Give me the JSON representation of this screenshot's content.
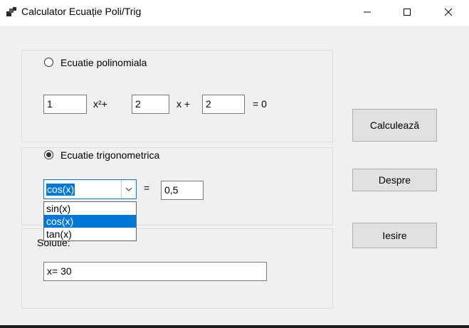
{
  "window": {
    "title": "Calculator Ecuație Poli/Trig",
    "icons": {
      "app": "app-icon",
      "minimize": "minimize-icon",
      "maximize": "maximize-icon",
      "close": "close-icon"
    }
  },
  "polynomial": {
    "radio_label": "Ecuatie polinomiala",
    "selected": false,
    "coef_a": "1",
    "x2_term": "x²+",
    "coef_b": "2",
    "x_term": "x +",
    "coef_c": "2",
    "equals_zero": "= 0"
  },
  "trigonometric": {
    "radio_label": "Ecuatie trigonometrica",
    "selected": true,
    "function_selected": "cos(x)",
    "equals": "=",
    "value": "0,5",
    "options": [
      "sin(x)",
      "cos(x)",
      "tan(x)"
    ],
    "highlighted_option": "cos(x)",
    "arrow_icon": "chevron-down-icon"
  },
  "solution": {
    "label": "Solutie:",
    "value": "x= 30"
  },
  "buttons": {
    "calculate": "Calculează",
    "about": "Despre",
    "exit": "Iesire"
  },
  "colors": {
    "accent": "#0078d7",
    "window_bg": "#f0f0f0",
    "button_bg": "#e1e1e1"
  }
}
